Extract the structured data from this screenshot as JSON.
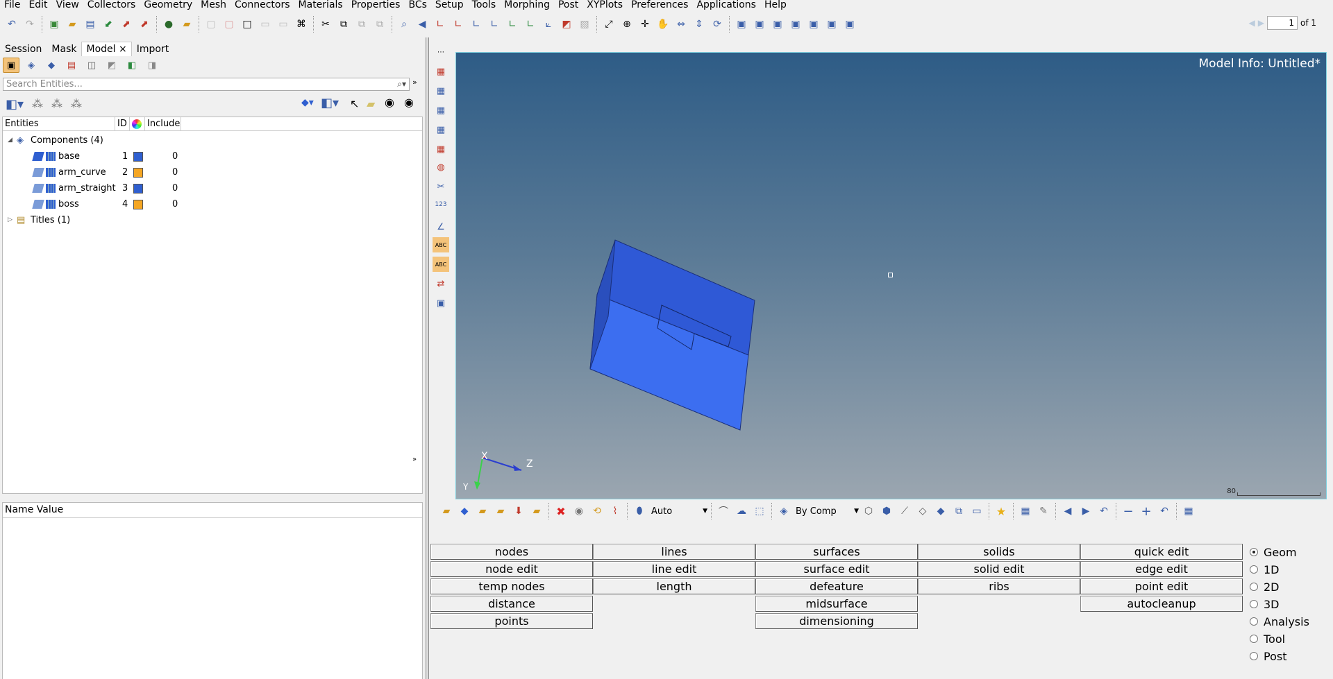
{
  "menu": [
    "File",
    "Edit",
    "View",
    "Collectors",
    "Geometry",
    "Mesh",
    "Connectors",
    "Materials",
    "Properties",
    "BCs",
    "Setup",
    "Tools",
    "Morphing",
    "Post",
    "XYPlots",
    "Preferences",
    "Applications",
    "Help"
  ],
  "pager": {
    "page": "1",
    "of": "of 1"
  },
  "left_tabs": [
    "Session",
    "Mask",
    "Model",
    "Import"
  ],
  "model_tab_close": "×",
  "search": {
    "placeholder": "Search Entities..."
  },
  "tree": {
    "headers": {
      "entities": "Entities",
      "id": "ID",
      "include": "Include"
    },
    "components_label": "Components (4)",
    "components": [
      {
        "name": "base",
        "id": "1",
        "color": "#2f5fd0",
        "include": "0"
      },
      {
        "name": "arm_curve",
        "id": "2",
        "color": "#f5a623",
        "include": "0"
      },
      {
        "name": "arm_straight",
        "id": "3",
        "color": "#2f5fd0",
        "include": "0"
      },
      {
        "name": "boss",
        "id": "4",
        "color": "#f5a623",
        "include": "0"
      }
    ],
    "titles_label": "Titles (1)"
  },
  "name_value_header": "Name Value",
  "viewport": {
    "model_info": "Model Info: Untitled*",
    "axis_x": "X",
    "axis_y": "Y",
    "axis_z": "Z",
    "scale_label": "80"
  },
  "bottom_toolbar": {
    "display_mode": "Auto",
    "color_mode": "By Comp"
  },
  "panel": {
    "col1": [
      "nodes",
      "node edit",
      "temp nodes",
      "distance",
      "points"
    ],
    "col2": [
      "lines",
      "line edit",
      "length"
    ],
    "col3": [
      "surfaces",
      "surface edit",
      "defeature",
      "midsurface",
      "dimensioning"
    ],
    "col4": [
      "solids",
      "solid edit",
      "ribs"
    ],
    "col5": [
      "quick edit",
      "edge edit",
      "point edit",
      "autocleanup"
    ],
    "radios": [
      "Geom",
      "1D",
      "2D",
      "3D",
      "Analysis",
      "Tool",
      "Post"
    ],
    "selected_radio": "Geom"
  }
}
